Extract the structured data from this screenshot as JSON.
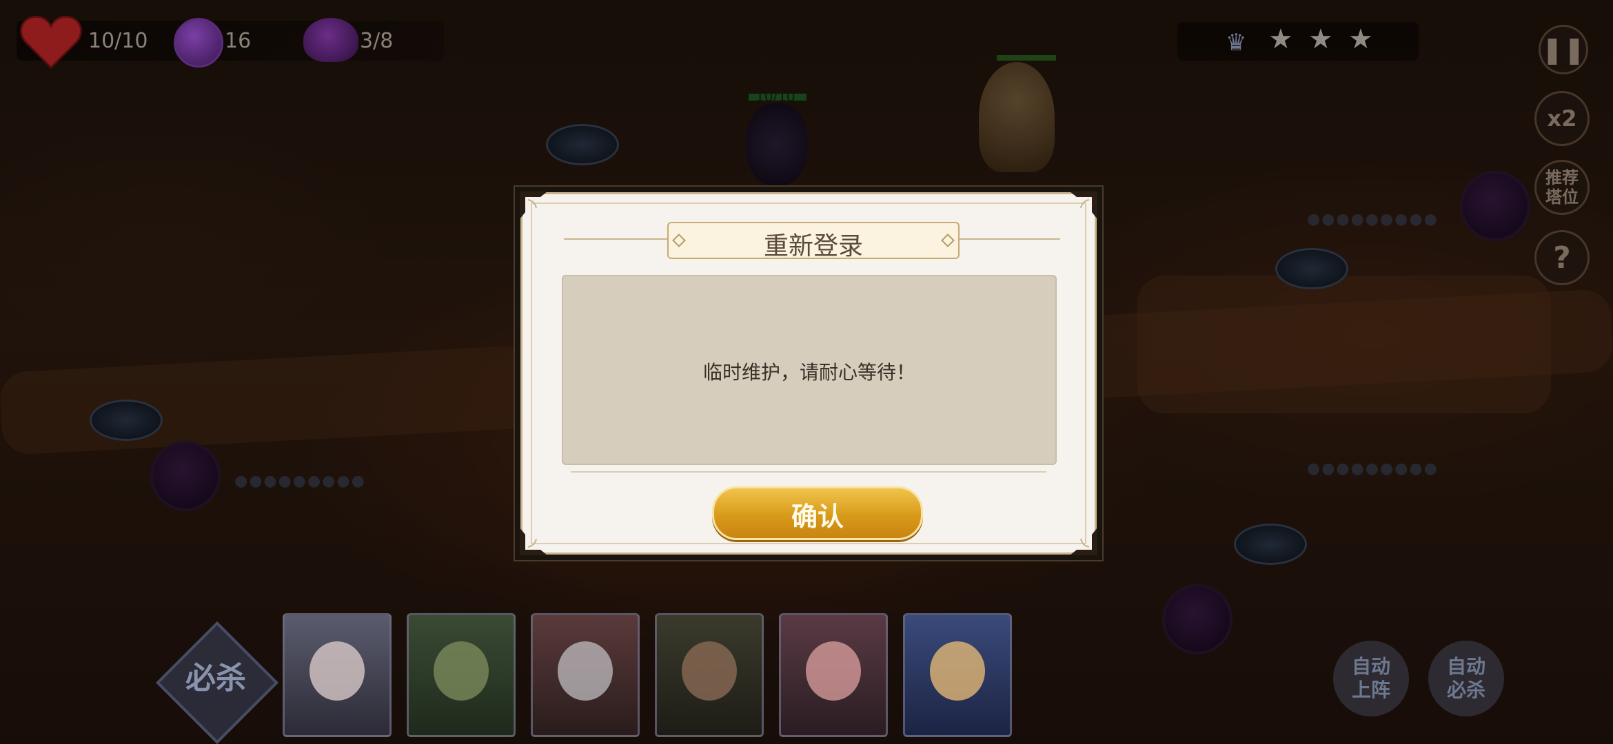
{
  "hud": {
    "lives": "10/10",
    "coins": "16",
    "wave": "3/8"
  },
  "buttons": {
    "speed": "x2",
    "recommend_line1": "推荐",
    "recommend_line2": "塔位",
    "help": "?",
    "skill": "必杀",
    "auto_deploy_line1": "自动",
    "auto_deploy_line2": "上阵",
    "auto_skill_line1": "自动",
    "auto_skill_line2": "必杀"
  },
  "enemy_hp": "10/10",
  "dialog": {
    "title": "重新登录",
    "message": "临时维护，请耐心等待！",
    "confirm": "确认"
  },
  "colors": {
    "confirm_button": "#e2a52a",
    "dialog_bg": "#f6f3ee",
    "message_box": "#d6cdbd"
  }
}
